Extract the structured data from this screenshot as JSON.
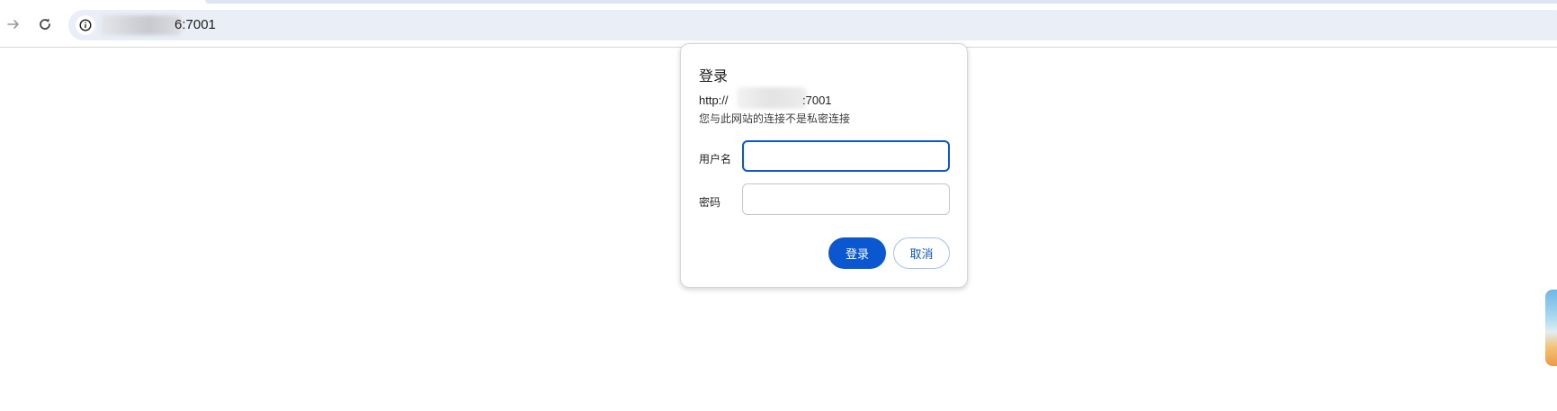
{
  "browser": {
    "address_bar": {
      "url_suffix": "6:7001"
    },
    "icons": {
      "forward": "arrow-forward-icon",
      "reload": "reload-icon",
      "site_info": "info-icon"
    }
  },
  "auth_dialog": {
    "title": "登录",
    "origin_prefix": "http://",
    "origin_port": ":7001",
    "warning": "您与此网站的连接不是私密连接",
    "username_label": "用户名",
    "username_value": "",
    "password_label": "密码",
    "password_value": "",
    "login_button": "登录",
    "cancel_button": "取消"
  },
  "colors": {
    "accent": "#0b57d0",
    "omnibox_bg": "#e9eef7"
  }
}
